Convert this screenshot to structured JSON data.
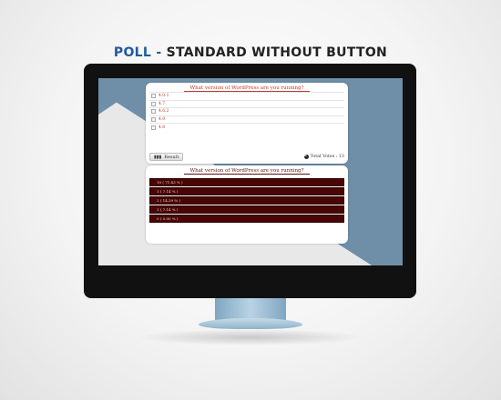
{
  "heading": {
    "poll": "POLL",
    "dash": "-",
    "rest": "STANDARD WITHOUT BUTTON"
  },
  "poll": {
    "question": "What version of WordPress are you running?",
    "options": [
      "4.0.1",
      "4.7",
      "4.6.2",
      "4.9",
      "4.8"
    ],
    "result_label": "Result",
    "total_votes": "Total Votes : 13"
  },
  "results": {
    "question": "What version of WordPress are you running?",
    "rows": [
      "10 ( 71.43 % )",
      "1 ( 7.14 % )",
      "2 ( 14.29 % )",
      "1 ( 7.14 % )",
      "0 ( 0.00 % )"
    ]
  },
  "colors": {
    "accent": "#c0392b",
    "result_bar": "#4a0505",
    "heading_blue": "#1f5aa0"
  }
}
